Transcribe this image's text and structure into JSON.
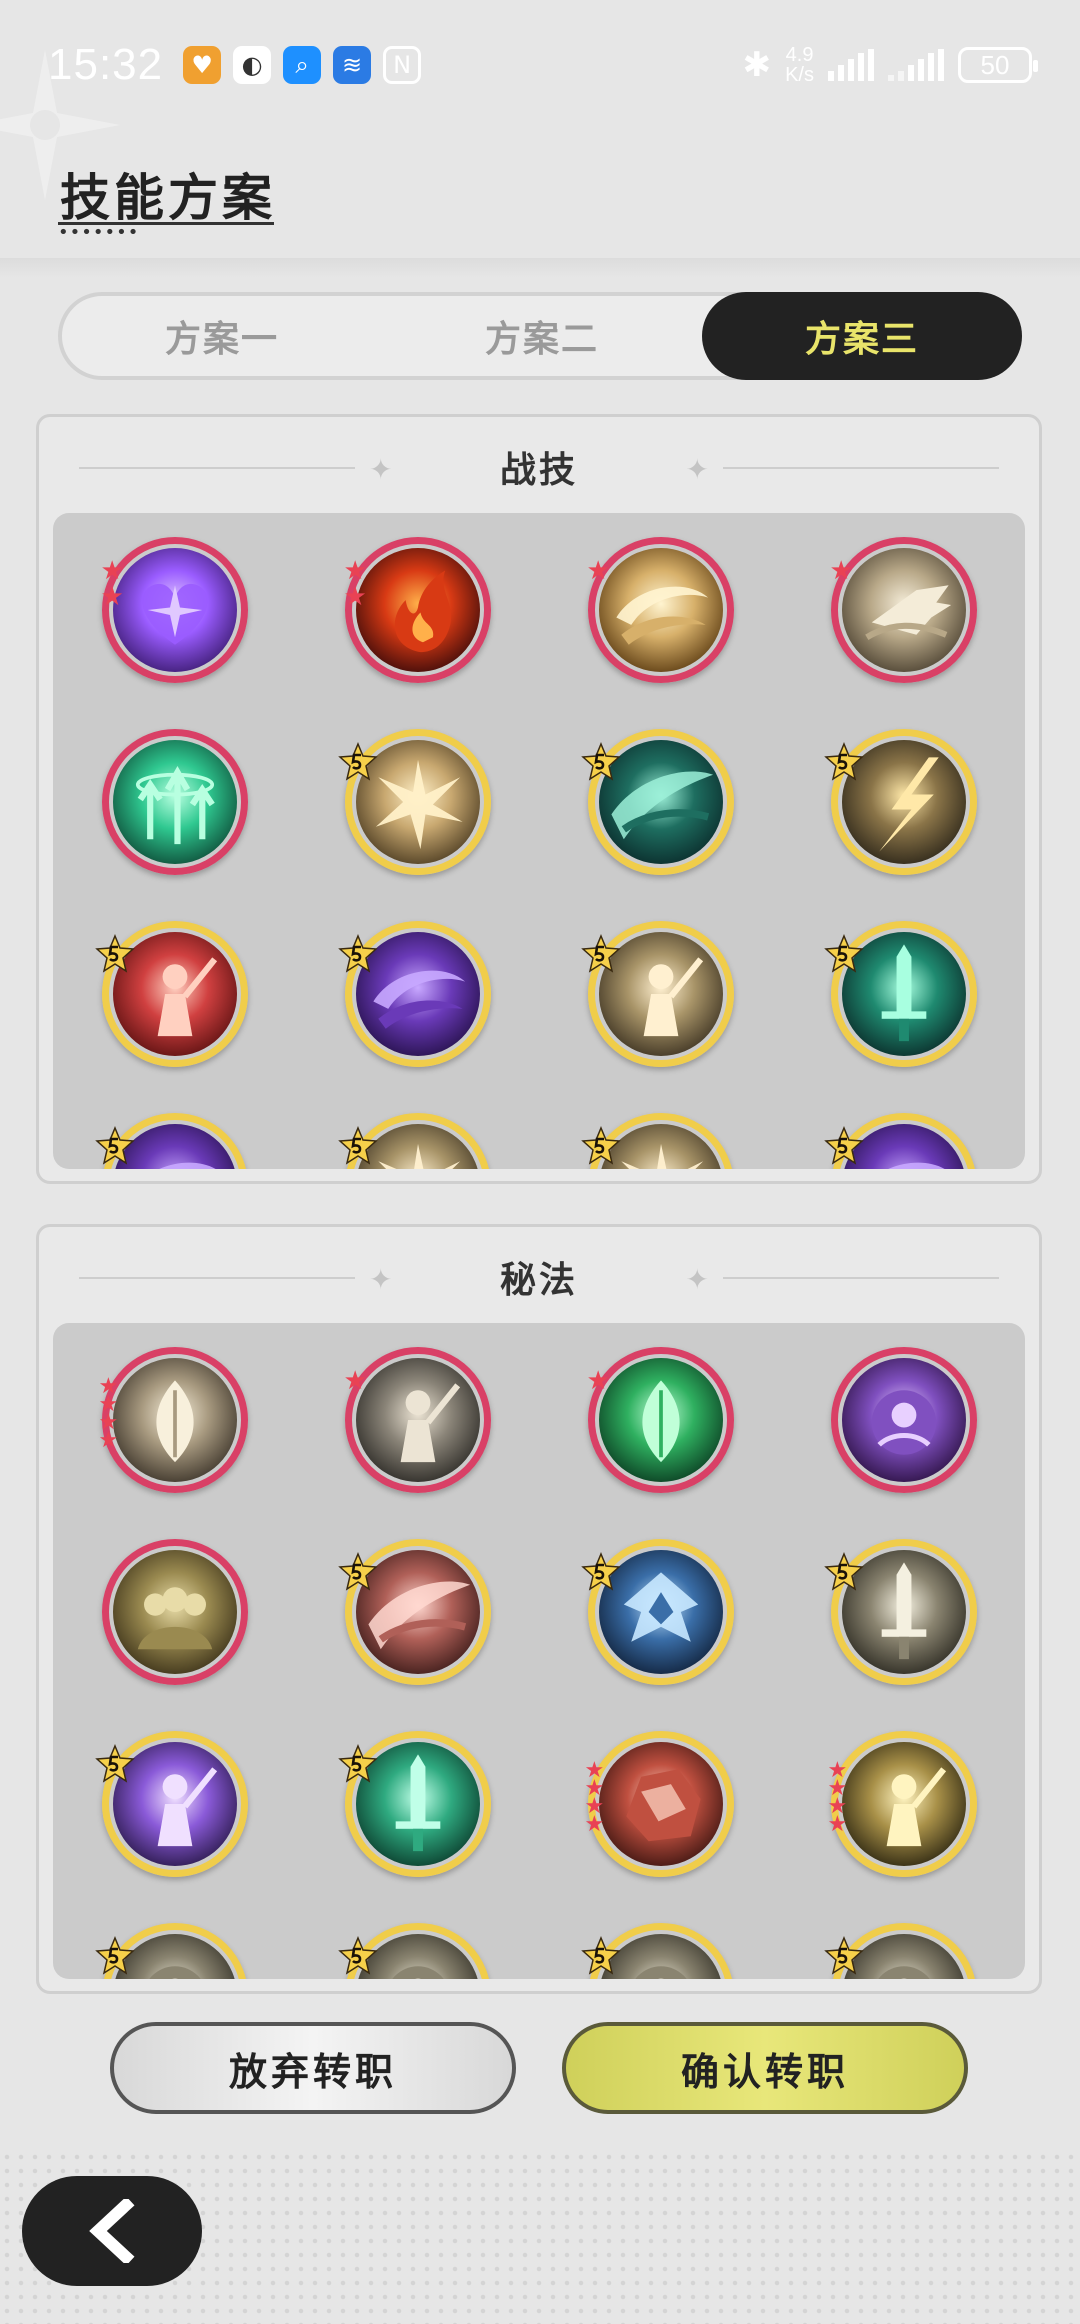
{
  "status_bar": {
    "time": "15:32",
    "net_speed_value": "4.9",
    "net_speed_unit": "K/s",
    "battery": "50"
  },
  "header": {
    "title": "技能方案"
  },
  "tabs": [
    {
      "label": "方案一",
      "active": false
    },
    {
      "label": "方案二",
      "active": false
    },
    {
      "label": "方案三",
      "active": true
    }
  ],
  "sections": [
    {
      "title": "战技"
    },
    {
      "title": "秘法"
    }
  ],
  "actions": {
    "abandon_label": "放弃转职",
    "confirm_label": "确认转职"
  },
  "colors": {
    "accent_yellow": "#e9e46a",
    "frame_red": "#d94066",
    "frame_gold": "#f0cd4a",
    "confirm_bg": "#e0df6c"
  }
}
